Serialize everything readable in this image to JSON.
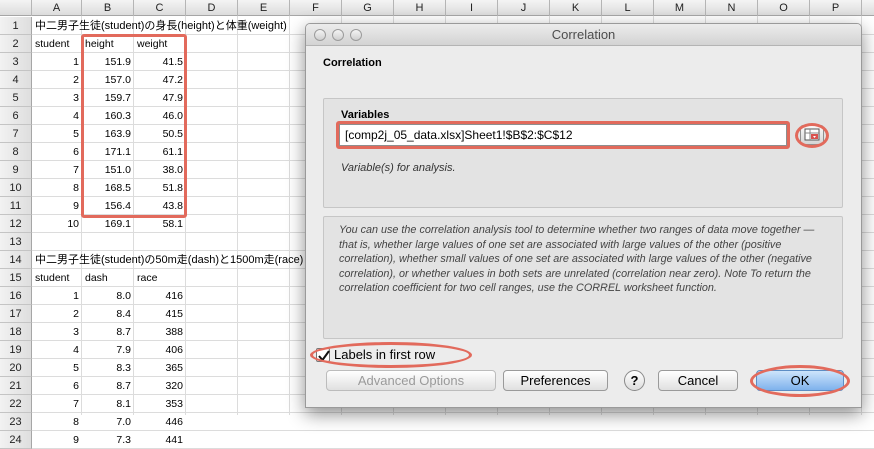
{
  "sheet": {
    "columns": [
      "A",
      "B",
      "C",
      "D",
      "E",
      "F",
      "G",
      "H",
      "I",
      "J",
      "K",
      "L",
      "M",
      "N",
      "O",
      "P"
    ],
    "row_numbers": [
      "1",
      "2",
      "3",
      "4",
      "5",
      "6",
      "7",
      "8",
      "9",
      "10",
      "11",
      "12",
      "13",
      "14",
      "15",
      "16",
      "17",
      "18",
      "19",
      "20",
      "21",
      "22",
      "23",
      "24"
    ],
    "title1": "中二男子生徒(student)の身長(height)と体重(weight)",
    "header1": [
      "student",
      "height",
      "weight"
    ],
    "table1": [
      [
        "1",
        "151.9",
        "41.5"
      ],
      [
        "2",
        "157.0",
        "47.2"
      ],
      [
        "3",
        "159.7",
        "47.9"
      ],
      [
        "4",
        "160.3",
        "46.0"
      ],
      [
        "5",
        "163.9",
        "50.5"
      ],
      [
        "6",
        "171.1",
        "61.1"
      ],
      [
        "7",
        "151.0",
        "38.0"
      ],
      [
        "8",
        "168.5",
        "51.8"
      ],
      [
        "9",
        "156.4",
        "43.8"
      ],
      [
        "10",
        "169.1",
        "58.1"
      ]
    ],
    "title2": "中二男子生徒(student)の50m走(dash)と1500m走(race)",
    "header2": [
      "student",
      "dash",
      "race"
    ],
    "table2": [
      [
        "1",
        "8.0",
        "416"
      ],
      [
        "2",
        "8.4",
        "415"
      ],
      [
        "3",
        "8.7",
        "388"
      ],
      [
        "4",
        "7.9",
        "406"
      ],
      [
        "5",
        "8.3",
        "365"
      ],
      [
        "6",
        "8.7",
        "320"
      ],
      [
        "7",
        "8.1",
        "353"
      ],
      [
        "8",
        "7.0",
        "446"
      ],
      [
        "9",
        "7.3",
        "441"
      ]
    ]
  },
  "dialog": {
    "window_title": "Correlation",
    "section_title": "Correlation",
    "variables_label": "Variables",
    "variables_value": "[comp2j_05_data.xlsx]Sheet1!$B$2:$C$12",
    "variables_hint": "Variable(s) for analysis.",
    "description": "You can use the correlation analysis tool to determine whether two ranges of data move together — that is, whether large values of one set are associated with large values of the other (positive correlation), whether small values of one set are associated with large values of the other (negative correlation), or whether values in both sets are unrelated (correlation near zero).    Note    To return the correlation coefficient for two cell ranges, use the CORREL worksheet function.",
    "labels_checkbox": "Labels in first row",
    "labels_checked": true,
    "buttons": {
      "advanced": "Advanced Options",
      "preferences": "Preferences",
      "help": "?",
      "cancel": "Cancel",
      "ok": "OK"
    }
  },
  "colors": {
    "highlight": "#e26a5c",
    "default_button": "#7fb2ec"
  }
}
